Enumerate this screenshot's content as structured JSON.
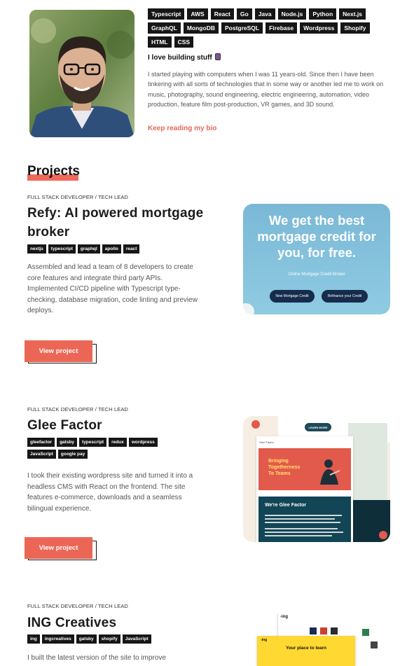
{
  "profile": {
    "tech_tags": [
      "Typescript",
      "AWS",
      "React",
      "Go",
      "Java",
      "Node.js",
      "Python",
      "Next.js",
      "GraphQL",
      "MongoDB",
      "PostgreSQL",
      "Firebase",
      "Wordpress",
      "Shopify",
      "HTML",
      "CSS"
    ],
    "about_title": "I love building stuff",
    "about_text": "I started playing with computers when I was 11 years-old. Since then I have been tinkering with all sorts of technologies that in some way or another led me to work on music, photography, sound engineering, electric engineering, automation, video production, feature film post-production, VR games, and 3D sound.",
    "read_more": "Keep reading my bio"
  },
  "projects_heading": "Projects",
  "projects": [
    {
      "role": "FULL STACK DEVELOPER / TECH LEAD",
      "title": "Refy: AI powered mortgage broker",
      "tags": [
        "nextjs",
        "typescript",
        "graphql",
        "apollo",
        "react"
      ],
      "description": "Assembled and lead a team of 8 developers to create core features and integrate third party APIs. Implemented CI/CD pipeline with Typescript type-checking, database migration, code linting and preview deploys.",
      "button": "View project",
      "screenshot": {
        "headline": "We get the best mortgage credit for you, for free.",
        "subtitle": "Online Mortgage Credit Broker",
        "button_1": "New Mortgage Credit",
        "button_2": "Refinance your Credit"
      }
    },
    {
      "role": "FULL STACK DEVELOPER / TECH LEAD",
      "title": "Glee Factor",
      "tags": [
        "gleefactor",
        "gatsby",
        "typescript",
        "redux",
        "wordpress",
        "JavaScript",
        "google pay"
      ],
      "description": "I took their existing wordpress site and turned it into a headless CMS with React on the frontend. The site features e-commerce, downloads and a seamless bilingual experience.",
      "button": "View project",
      "screenshot": {
        "pill": "LEARN MORE",
        "nav_brand": "Glee Factor",
        "hero": "Bringing Togetherness To Teams",
        "section": "We're Glee Factor"
      }
    },
    {
      "role": "FULL STACK DEVELOPER / TECH LEAD",
      "title": "ING Creatives",
      "tags": [
        "ing",
        "ingcreatives",
        "gatsby",
        "shopify",
        "JavaScript"
      ],
      "description": "I built the latest version of the site to improve",
      "button": "View project",
      "screenshot": {
        "logo": "-ing",
        "logo_2": "-ing",
        "headline": "Your place to learn"
      }
    }
  ],
  "colors": {
    "accent": "#ec6655",
    "tag_bg": "#161616",
    "refy_bg": "#8fcbe2",
    "glee_bg": "#f6eee2",
    "ing_yellow": "#ffd832"
  }
}
